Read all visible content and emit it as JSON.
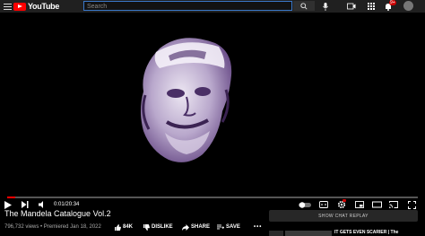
{
  "header": {
    "logo_text": "YouTube",
    "search_placeholder": "Search",
    "notification_count": "9+"
  },
  "player": {
    "progress": 0.003,
    "current_time": "0:01",
    "duration": "20:34",
    "time_separator": " / ",
    "accent": "#ff0000"
  },
  "video": {
    "title": "The Mandela Catalogue Vol.2",
    "views": "796,732 views",
    "premiered": "Premiered Jan 18, 2022",
    "separator": " • "
  },
  "actions": {
    "like_count": "84K",
    "dislike_label": "DISLIKE",
    "share_label": "SHARE",
    "save_label": "SAVE"
  },
  "sidebar": {
    "show_chat_replay": "SHOW CHAT REPLAY",
    "next_video_title": "IT GETS EVEN SCARIER | The"
  }
}
